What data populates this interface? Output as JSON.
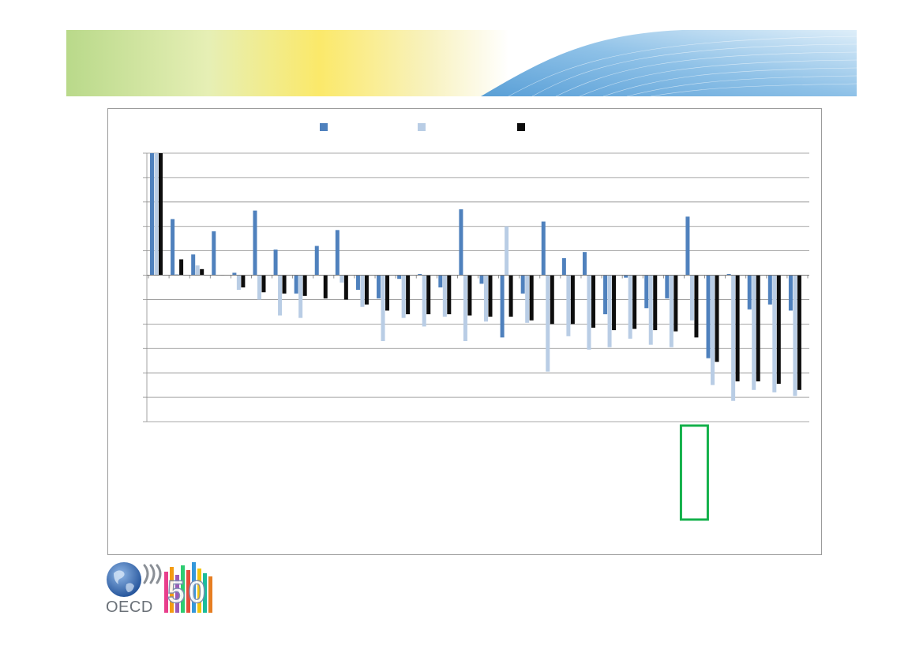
{
  "logo": {
    "name": "OECD",
    "anniversary": "50"
  },
  "colors": {
    "series_1": "#4f81bd",
    "series_2": "#b9cde5",
    "series_3": "#0d0d0d",
    "highlight": "#14b14b",
    "grid": "#8c8c8c"
  },
  "chart_data": {
    "type": "bar",
    "ylim": [
      -6,
      5
    ],
    "y_tick_step": 1,
    "grid": true,
    "legend": "top-center",
    "highlight_category_index": 26,
    "categories_count": 32,
    "series": [
      {
        "values": [
          5.0,
          2.3,
          0.85,
          1.8,
          0.1,
          2.65,
          1.05,
          -0.75,
          1.2,
          1.85,
          -0.6,
          -0.95,
          -0.15,
          0.05,
          -0.5,
          2.7,
          -0.35,
          -2.55,
          -0.75,
          2.2,
          0.7,
          0.95,
          -1.6,
          -0.1,
          -1.35,
          -0.95,
          2.4,
          -3.4,
          0.05,
          -1.4,
          -1.2,
          -1.45
        ]
      },
      {
        "values": [
          5.0,
          0.05,
          0.4,
          0.0,
          -0.6,
          -1.0,
          -1.65,
          -1.75,
          0.0,
          -0.3,
          -1.3,
          -2.7,
          -1.75,
          -2.1,
          -1.7,
          -2.7,
          -1.9,
          2.0,
          -1.95,
          -3.95,
          -2.5,
          -3.05,
          -2.95,
          -2.6,
          -2.85,
          -2.95,
          -1.85,
          -4.5,
          -5.15,
          -4.7,
          -4.8,
          -4.95
        ]
      },
      {
        "values": [
          5.0,
          0.65,
          0.25,
          0.0,
          -0.5,
          -0.7,
          -0.75,
          -0.85,
          -0.95,
          -1.0,
          -1.2,
          -1.45,
          -1.6,
          -1.6,
          -1.6,
          -1.65,
          -1.7,
          -1.7,
          -1.85,
          -2.0,
          -2.0,
          -2.15,
          -2.25,
          -2.2,
          -2.25,
          -2.3,
          -2.55,
          -3.55,
          -4.35,
          -4.35,
          -4.45,
          -4.7
        ]
      }
    ]
  }
}
